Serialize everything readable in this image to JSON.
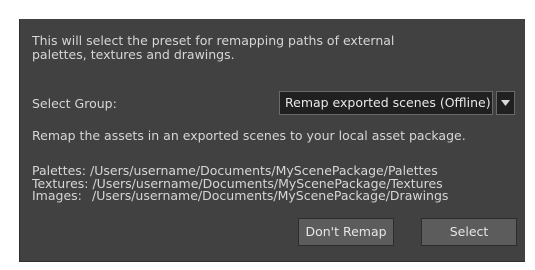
{
  "intro": {
    "line1": "This will select the preset for remapping paths of external",
    "line2": "palettes, textures and drawings."
  },
  "group": {
    "label": "Select Group:",
    "selected": "Remap exported scenes (Offline)",
    "arrow_icon": "triangle-down-icon"
  },
  "description": "Remap the assets in an exported scenes to your local asset package.",
  "paths": {
    "palettes_label": "Palettes:",
    "palettes_value": "/Users/username/Documents/MyScenePackage/Palettes",
    "textures_label": "Textures:",
    "textures_value": "/Users/username/Documents/MyScenePackage/Textures",
    "images_label": "Images:",
    "images_value": "/Users/username/Documents/MyScenePackage/Drawings"
  },
  "buttons": {
    "dont_remap": "Don't Remap",
    "select": "Select"
  },
  "colors": {
    "dialog_bg": "#414141",
    "text": "#d6d6d6",
    "field_bg": "#202020",
    "button_bg": "#5c5c5c"
  }
}
